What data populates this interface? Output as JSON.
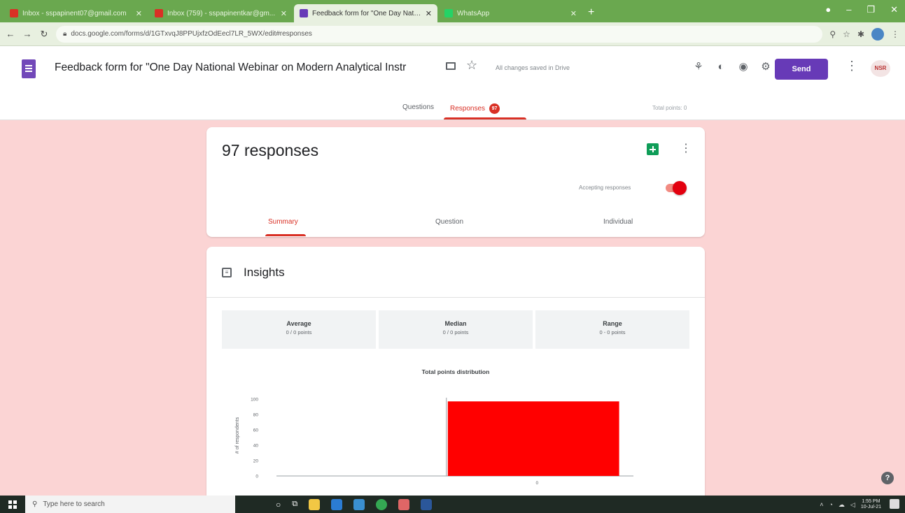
{
  "browser": {
    "tabs": [
      {
        "label": "Inbox - sspapinent07@gmail.com",
        "favicon_color": "#d93025",
        "active": false
      },
      {
        "label": "Inbox (759) - sspapinentkar@gm...",
        "favicon_color": "#d93025",
        "active": false
      },
      {
        "label": "Feedback form for \"One Day Nati...",
        "favicon_color": "#673ab7",
        "active": true
      },
      {
        "label": "WhatsApp",
        "favicon_color": "#25d366",
        "active": false
      }
    ],
    "new_tab": "+",
    "url": "docs.google.com/forms/d/1GTxvqJ8PPUjxfzOdEecl7LR_5WX/edit#responses"
  },
  "header": {
    "form_title": "Feedback form for \"One Day National Webinar on Modern Analytical Instr",
    "saved_status": "All changes saved in Drive",
    "send_label": "Send",
    "avatar_text": "NSR",
    "tabs": {
      "questions": "Questions",
      "responses": "Responses",
      "responses_count": "97"
    },
    "total_points": "Total points: 0"
  },
  "responses_card": {
    "title": "97 responses",
    "accepting_label": "Accepting responses",
    "sub_tabs": {
      "summary": "Summary",
      "question": "Question",
      "individual": "Individual"
    }
  },
  "insights": {
    "title": "Insights",
    "stats": [
      {
        "label": "Average",
        "value": "0 / 0 points"
      },
      {
        "label": "Median",
        "value": "0 / 0 points"
      },
      {
        "label": "Range",
        "value": "0 - 0 points"
      }
    ]
  },
  "chart_data": {
    "type": "bar",
    "title": "Total points distribution",
    "xlabel": "",
    "ylabel": "# of respondents",
    "categories": [
      "0"
    ],
    "values": [
      97
    ],
    "yticks": [
      0,
      20,
      40,
      60,
      80,
      100
    ],
    "ylim": [
      0,
      100
    ],
    "bar_color": "#ff0000"
  },
  "taskbar": {
    "search_placeholder": "Type here to search",
    "time": "1:55 PM",
    "date": "10-Jul-21"
  },
  "colors": {
    "accent": "#d93025",
    "brand": "#673ab7",
    "page_bg": "#fbd4d4"
  }
}
